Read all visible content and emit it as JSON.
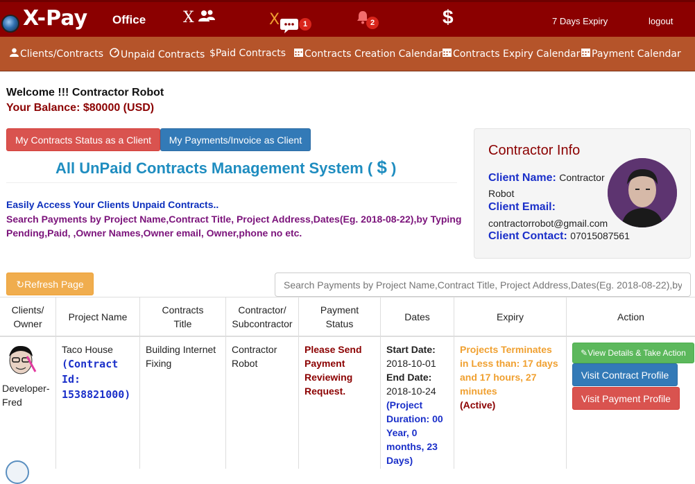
{
  "header": {
    "brand": "X-Pay",
    "office": "Office",
    "x_letter": "X",
    "messages_badge": "1",
    "notifications_badge": "2",
    "payments_symbol": "$",
    "expiry": "7 Days Expiry",
    "logout": "logout"
  },
  "subnav": {
    "items": [
      {
        "label": "Clients/Contracts",
        "icon": "user-icon"
      },
      {
        "label": "Unpaid Contracts",
        "icon": "dashboard-icon"
      },
      {
        "label": "Paid Contracts",
        "icon": "dollar-icon"
      },
      {
        "label": "Contracts Creation Calendar",
        "icon": "calendar-icon"
      },
      {
        "label": "Contracts Expiry Calendar",
        "icon": "calendar-icon"
      },
      {
        "label": "Payment Calendar",
        "icon": "calendar-icon"
      }
    ]
  },
  "welcome": {
    "greeting": "Welcome !!! Contractor Robot",
    "balance": "Your Balance: $80000 (USD)"
  },
  "actions": {
    "status_btn": "My Contracts Status as a Client",
    "payments_btn": "My Payments/Invoice as Client",
    "refresh_btn": "Refresh Page"
  },
  "system": {
    "title": "All UnPaid Contracts Management System (",
    "title_dollar": "$",
    "title_close": ")",
    "desc1": "Easily Access Your Clients Unpaid Contracts..",
    "desc2": "Search Payments by Project Name,Contract Title, Project Address,Dates(Eg. 2018-08-22),by Typing Pending,Paid, ,Owner Names,Owner email, Owner,phone no etc."
  },
  "info": {
    "title": "Contractor Info",
    "name_label": "Client Name:",
    "name_value_1": "Contractor",
    "name_value_2": "Robot",
    "email_label": "Client Email:",
    "email_value": "contractorrobot@gmail.com",
    "contact_label": "Client Contact:",
    "contact_value": "07015087561"
  },
  "search": {
    "placeholder": "Search Payments by Project Name,Contract Title, Project Address,Dates(Eg. 2018-08-22),by"
  },
  "table": {
    "headers": {
      "owner_1": "Clients/",
      "owner_2": "Owner",
      "project": "Project Name",
      "title_1": "Contracts",
      "title_2": "Title",
      "contractor_1": "Contractor/",
      "contractor_2": "Subcontractor",
      "status_1": "Payment",
      "status_2": "Status",
      "dates": "Dates",
      "expiry": "Expiry",
      "action": "Action"
    },
    "row": {
      "owner_1": "Developer-",
      "owner_2": "Fred",
      "project_name": "Taco House",
      "contract_id_1": "(Contract",
      "contract_id_2": "Id:",
      "contract_id_3": "1538821000)",
      "title_1": "Building Internet",
      "title_2": "Fixing",
      "contractor_1": "Contractor",
      "contractor_2": "Robot",
      "status_1": "Please Send",
      "status_2": "Payment",
      "status_3": "Reviewing",
      "status_4": "Request.",
      "start_label": "Start Date:",
      "start_value": "2018-10-01",
      "end_label": "End Date:",
      "end_value": "2018-10-24",
      "duration_1": "(Project",
      "duration_2": "Duration: 00",
      "duration_3": "Year, 0",
      "duration_4": "months, 23",
      "duration_5": "Days)",
      "expiry_1": "Projects Terminates",
      "expiry_2": "in Less than: 17 days",
      "expiry_3": "and 17 hours, 27",
      "expiry_4": "minutes",
      "expiry_active": "(Active)",
      "btn_details": "View Details & Take Action",
      "btn_contract": "Visit Contract Profile",
      "btn_payment": "Visit Payment Profile"
    }
  },
  "colors": {
    "header_bg": "#8b0000",
    "subnav_bg": "#b5542a",
    "title_blue": "#1f8dc0",
    "status_red": "#8b0000",
    "expiry_orange": "#f0a030"
  }
}
